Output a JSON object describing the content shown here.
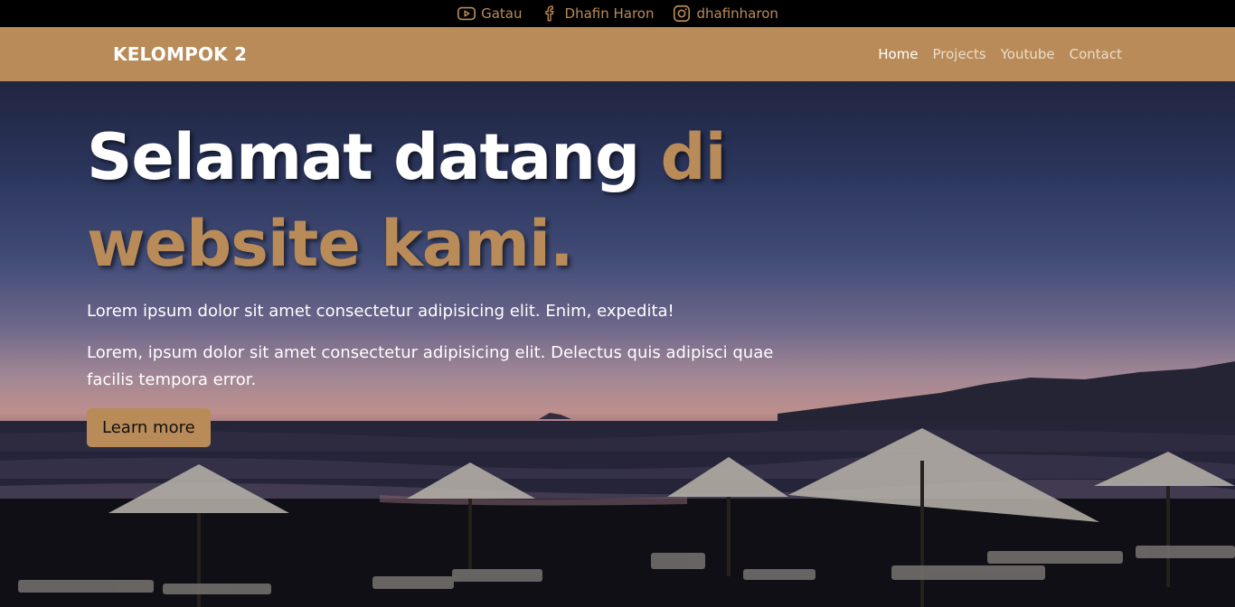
{
  "topbar": {
    "links": [
      {
        "icon": "youtube-icon",
        "label": "Gatau"
      },
      {
        "icon": "facebook-icon",
        "label": "Dhafin Haron"
      },
      {
        "icon": "instagram-icon",
        "label": "dhafinharon"
      }
    ]
  },
  "navbar": {
    "brand": "KELOMPOK 2",
    "links": [
      "Home",
      "Projects",
      "Youtube",
      "Contact"
    ],
    "active": "Home"
  },
  "hero": {
    "title_white": "Selamat datang ",
    "title_accent_1": "di",
    "title_accent_2": "website kami.",
    "paragraph_1": "Lorem ipsum dolor sit amet consectetur adipisicing elit. Enim, expedita!",
    "paragraph_2": "Lorem, ipsum dolor sit amet consectetur adipisicing elit. Delectus quis adipisci quae facilis tempora error.",
    "button_label": "Learn more"
  },
  "colors": {
    "accent": "#b98b58",
    "topbar_bg": "#000000",
    "text": "#ffffff"
  }
}
